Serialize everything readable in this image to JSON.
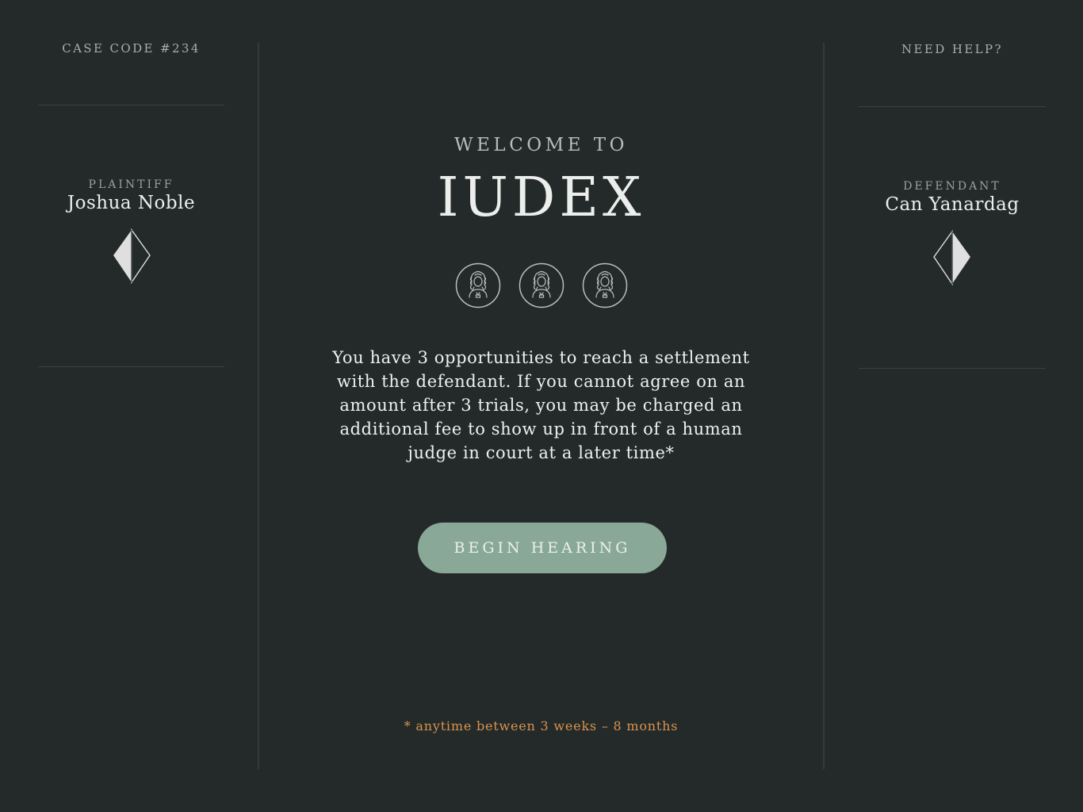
{
  "case": {
    "code_label": "CASE CODE #234"
  },
  "help": {
    "label": "NEED HELP?"
  },
  "plaintiff": {
    "role": "PLAINTIFF",
    "name": "Joshua Noble",
    "icon": "gem-left-filled-icon"
  },
  "defendant": {
    "role": "DEFENDANT",
    "name": "Can Yanardag",
    "icon": "gem-right-filled-icon"
  },
  "welcome": {
    "kicker": "WELCOME TO",
    "title": "IUDEX",
    "judges": [
      {
        "icon": "judge-icon"
      },
      {
        "icon": "judge-icon"
      },
      {
        "icon": "judge-icon"
      }
    ],
    "description": "You have 3 opportunities to reach a settlement with the defendant. If you cannot agree on an amount after 3 trials, you may be charged an additional fee to show up in front of a human judge in court at a later time*",
    "begin_label": "BEGIN HEARING",
    "footnote": "* anytime between 3 weeks – 8 months"
  },
  "colors": {
    "background": "#232a29",
    "accent_button": "#8aa898",
    "footnote": "#d9934f",
    "divider": "#333b39"
  }
}
